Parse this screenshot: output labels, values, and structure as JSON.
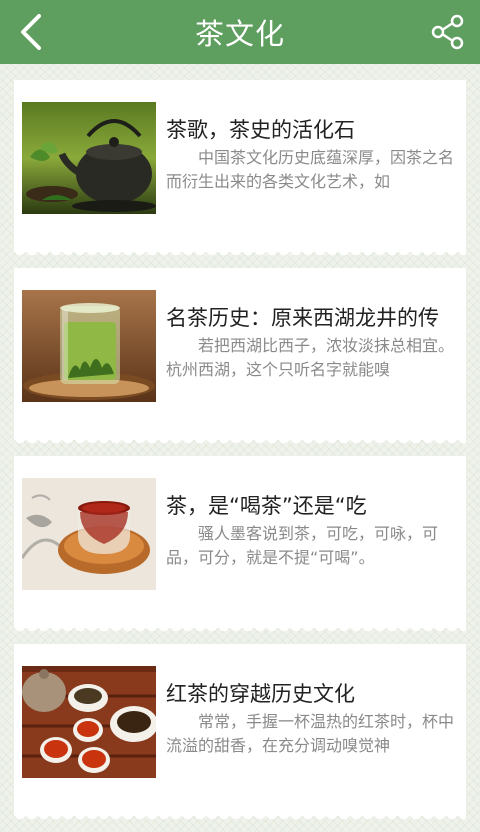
{
  "header": {
    "title": "茶文化",
    "back_icon": "back-arrow-icon",
    "share_icon": "share-icon",
    "bg_color": "#5e9e5f"
  },
  "articles": [
    {
      "title": "茶歌，茶史的活化石",
      "desc": "中国茶文化历史底蕴深厚，因茶之名而衍生出来的各类文化艺术，如",
      "thumb": "teapot-image"
    },
    {
      "title": "名茶历史：原来西湖龙井的传",
      "desc": "若把西湖比西子，浓妆淡抹总相宜。杭州西湖，这个只听名字就能嗅",
      "thumb": "longjing-tea-glass-image"
    },
    {
      "title": "茶，是“喝茶”还是“吃",
      "desc": "骚人墨客说到茶，可吃，可咏，可品，可分，就是不提“可喝”。",
      "thumb": "red-tea-cup-image"
    },
    {
      "title": "红茶的穿越历史文化",
      "desc": "常常，手握一杯温热的红茶时，杯中流溢的甜香，在充分调动嗅觉神",
      "thumb": "black-tea-set-image"
    }
  ]
}
